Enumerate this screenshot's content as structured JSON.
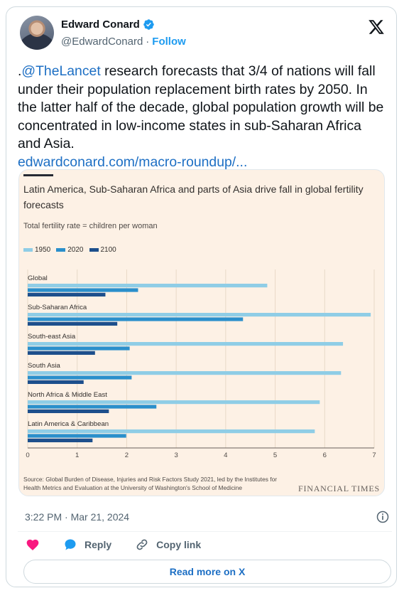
{
  "author": {
    "display_name": "Edward Conard",
    "handle": "@EdwardConard",
    "separator": "·",
    "follow_label": "Follow"
  },
  "tweet": {
    "prefix": ".",
    "mention": "@TheLancet",
    "body": " research forecasts that 3/4 of nations will fall under their population replacement birth rates by 2050. In the latter half of the decade, global population growth will be concentrated in low-income states in sub-Saharan Africa and Asia.",
    "link": "edwardconard.com/macro-roundup/..."
  },
  "chart_data": {
    "type": "bar",
    "orientation": "horizontal",
    "title": "Latin America, Sub-Saharan Africa and parts of Asia drive fall in global fertility forecasts",
    "subtitle": "Total fertility rate = children per woman",
    "categories": [
      "Global",
      "Sub-Saharan Africa",
      "South-east Asia",
      "South Asia",
      "North Africa & Middle East",
      "Latin America & Caribbean"
    ],
    "series": [
      {
        "name": "1950",
        "color": "#8fcde6",
        "values": [
          4.84,
          6.93,
          6.37,
          6.33,
          5.9,
          5.8
        ]
      },
      {
        "name": "2020",
        "color": "#2a8fcb",
        "values": [
          2.23,
          4.35,
          2.06,
          2.1,
          2.6,
          1.99
        ]
      },
      {
        "name": "2100",
        "color": "#1d4f8c",
        "values": [
          1.57,
          1.81,
          1.36,
          1.13,
          1.64,
          1.31
        ]
      }
    ],
    "xlim": [
      0,
      7
    ],
    "xticks": [
      "0",
      "1",
      "2",
      "3",
      "4",
      "5",
      "6",
      "7"
    ],
    "source": "Source: Global Burden of Disease, Injuries and Risk Factors Study 2021, led by the Institutes for Health Metrics and Evaluation at the University of Washington's School of Medicine",
    "publisher": "FINANCIAL TIMES",
    "background": "#fdf1e5"
  },
  "meta": {
    "timestamp": "3:22 PM · Mar 21, 2024"
  },
  "actions": {
    "reply_label": "Reply",
    "copy_label": "Copy link",
    "read_more_label": "Read more on X"
  },
  "colors": {
    "accent": "#1d9bf0",
    "link": "#1d6fc4",
    "heart": "#f91880"
  }
}
